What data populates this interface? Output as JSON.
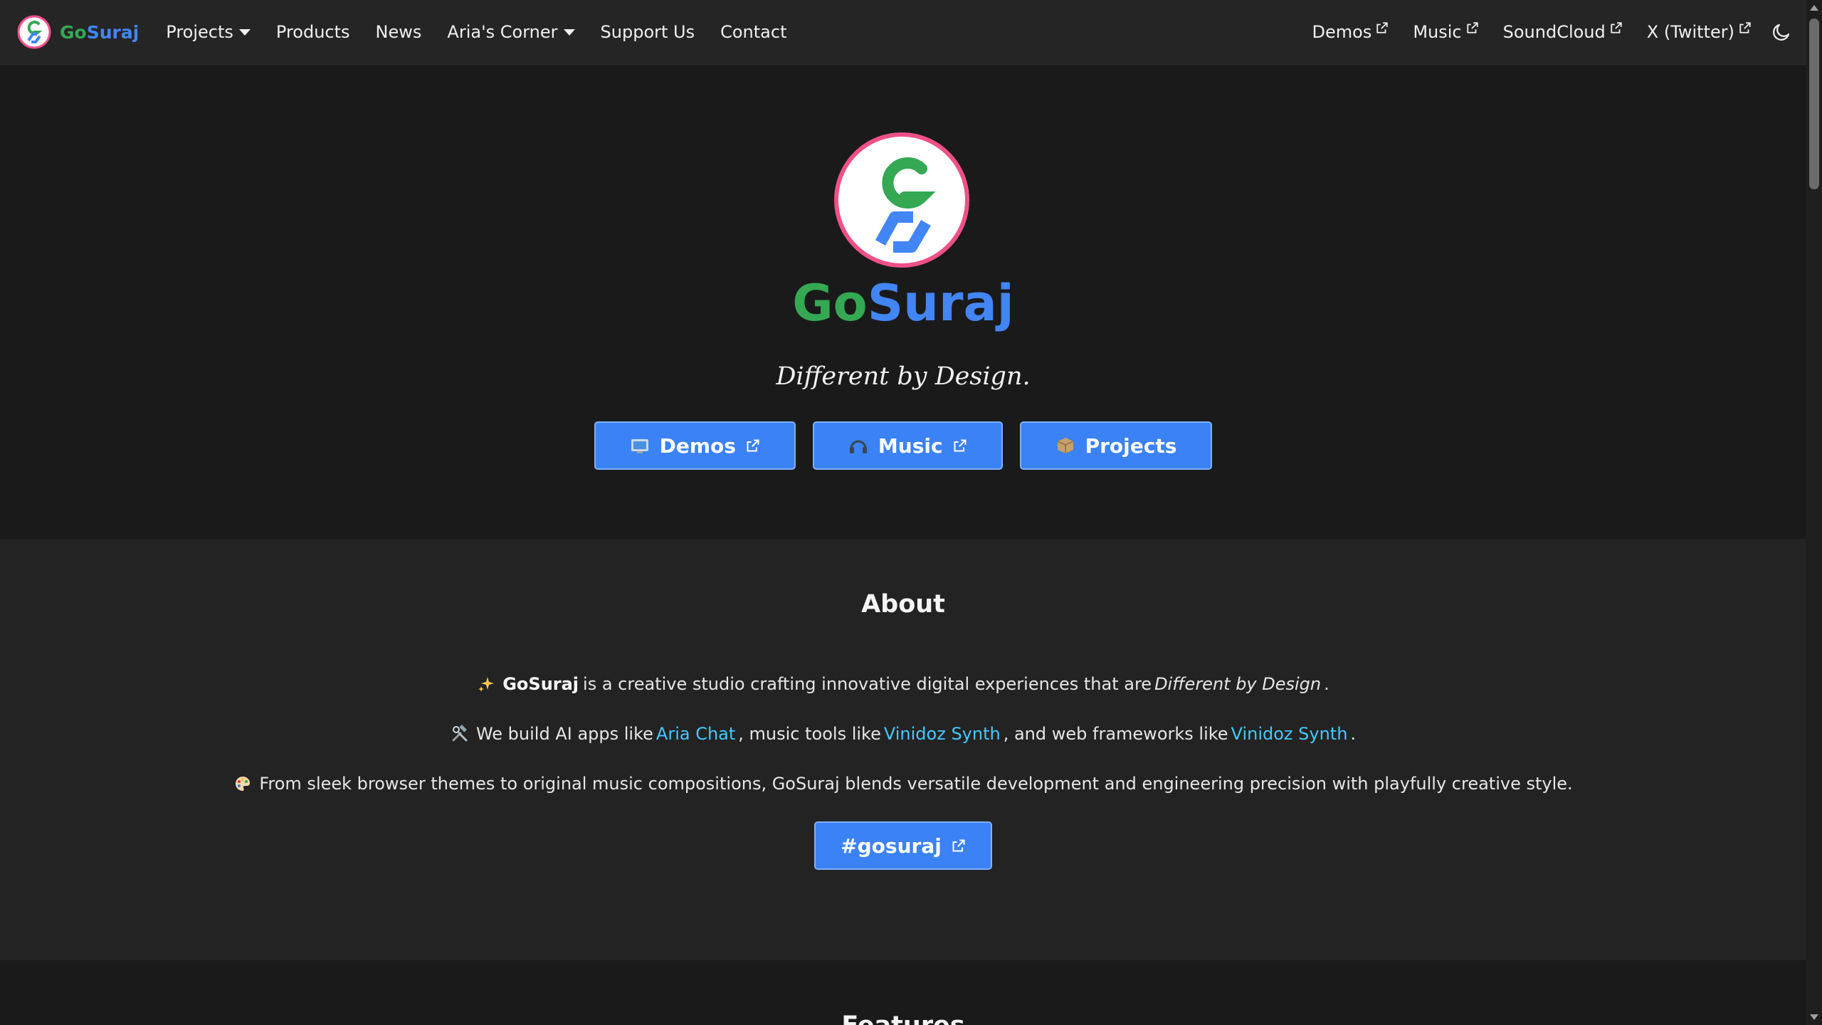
{
  "brand": {
    "go": "Go",
    "suraj": "Suraj"
  },
  "nav": {
    "left": [
      {
        "label": "Projects",
        "dropdown": true
      },
      {
        "label": "Products",
        "dropdown": false
      },
      {
        "label": "News",
        "dropdown": false
      },
      {
        "label": "Aria's Corner",
        "dropdown": true
      },
      {
        "label": "Support Us",
        "dropdown": false
      },
      {
        "label": "Contact",
        "dropdown": false
      }
    ],
    "right": [
      {
        "label": "Demos",
        "external": true
      },
      {
        "label": "Music",
        "external": true
      },
      {
        "label": "SoundCloud",
        "external": true
      },
      {
        "label": "X (Twitter)",
        "external": true
      }
    ],
    "theme_toggle_icon": "moon-icon"
  },
  "hero": {
    "title_go": "Go",
    "title_suraj": "Suraj",
    "tagline": "Different by Design.",
    "buttons": [
      {
        "label": "Demos",
        "icon": "tv-emoji",
        "external": true
      },
      {
        "label": "Music",
        "icon": "headphones-emoji",
        "external": true
      },
      {
        "label": "Projects",
        "icon": "package-emoji",
        "external": false
      }
    ]
  },
  "about": {
    "title": "About",
    "line1": {
      "brand": "GoSuraj",
      "text_before": "is a creative studio crafting innovative digital experiences that are",
      "emphasis": "Different by Design",
      "text_after": "."
    },
    "line2": {
      "text1": "We build AI apps like",
      "link1": "Aria Chat",
      "text2": ", music tools like",
      "link2": "Vinidoz Synth",
      "text3": ", and web frameworks like",
      "link3": "Vinidoz Synth",
      "text4": "."
    },
    "line3": {
      "text": "From sleek browser themes to original music compositions, GoSuraj blends versatile development and engineering precision with playfully creative style."
    },
    "hashtag_button": "#gosuraj"
  },
  "features": {
    "title": "Features"
  },
  "colors": {
    "accent": "#3b82f6",
    "brand_green": "#34a853",
    "brand_blue": "#4285f4",
    "link": "#45c8ff",
    "logo_ring": "#f0508a"
  }
}
